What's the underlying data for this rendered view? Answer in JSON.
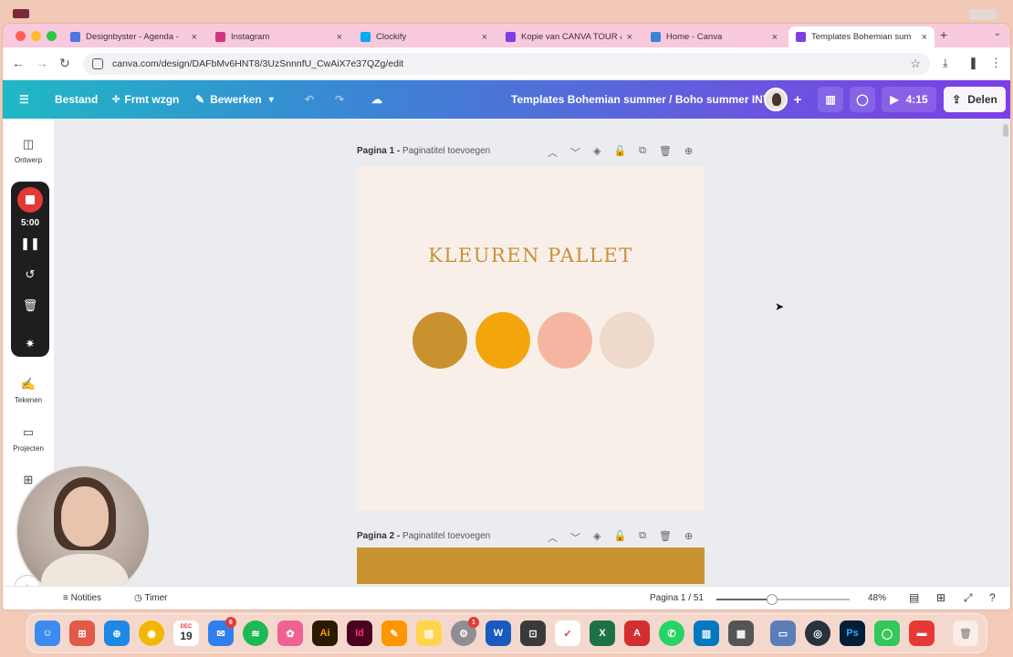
{
  "browser": {
    "tabs": [
      {
        "label": "Designbyster - Agenda -",
        "favicon_color": "#4a78e0",
        "active": false
      },
      {
        "label": "Instagram",
        "favicon_color": "#d6337f",
        "active": false
      },
      {
        "label": "Clockify",
        "favicon_color": "#03a9f4",
        "active": false
      },
      {
        "label": "Kopie van CANVA TOUR &",
        "favicon_color": "#7d3ee6",
        "active": false
      },
      {
        "label": "Home - Canva",
        "favicon_color": "#3a86d4",
        "active": false
      },
      {
        "label": "Templates Bohemian sum",
        "favicon_color": "#7d3ee6",
        "active": true
      }
    ],
    "tab_close": "×",
    "new_tab": "+",
    "url": "canva.com/design/DAFbMv6HNT8/3UzSnnnfU_CwAiX7e37QZg/edit"
  },
  "canva": {
    "menu": {
      "file": "Bestand",
      "resize": "Frmt wzgn",
      "edit": "Bewerken"
    },
    "title": "Templates Bohemian summer / Boho summer INTM",
    "present_time": "4:15",
    "share": "Delen"
  },
  "sidebar": {
    "items": [
      {
        "label": "Ontwerp"
      },
      {
        "label": "Tekenen"
      },
      {
        "label": "Projecten"
      }
    ]
  },
  "recorder": {
    "time": "5:00"
  },
  "pages": [
    {
      "number_label": "Pagina 1 -",
      "title_placeholder": "Paginatitel toevoegen"
    },
    {
      "number_label": "Pagina 2 -",
      "title_placeholder": "Paginatitel toevoegen"
    }
  ],
  "design": {
    "heading": "KLEUREN PALLET",
    "background_color": "#f8efe9",
    "swatches": [
      "#c9922f",
      "#f3a60c",
      "#f6b5a1",
      "#eed9cb"
    ],
    "page2_color": "#c99430"
  },
  "bottom": {
    "notes": "Notities",
    "timer": "Timer",
    "page_indicator": "Pagina 1 / 51",
    "zoom_percent": "48%",
    "zoom_fraction": 0.42
  },
  "dock": {
    "badges": {
      "mail": "6",
      "settings": "1"
    },
    "calendar_day": "19",
    "calendar_month": "DEC"
  }
}
